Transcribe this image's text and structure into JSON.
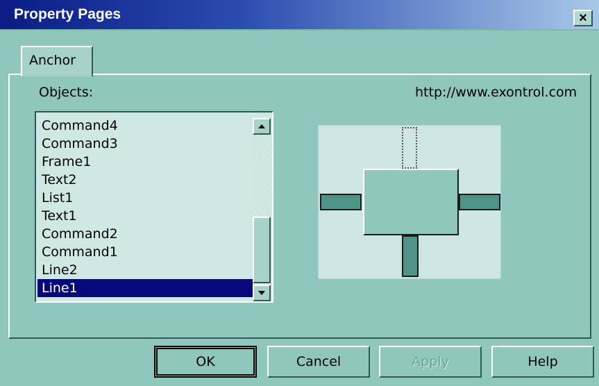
{
  "window": {
    "title": "Property Pages",
    "close_glyph": "×"
  },
  "tabs": [
    {
      "label": "Anchor",
      "selected": true
    }
  ],
  "objects": {
    "label": "Objects:",
    "items": [
      "Command4",
      "Command3",
      "Frame1",
      "Text2",
      "List1",
      "Text1",
      "Command2",
      "Command1",
      "Line2",
      "Line1"
    ],
    "selected": "Line1"
  },
  "url": "http://www.exontrol.com",
  "preview": {
    "top_anchor": "dotted",
    "left_anchor": "solid",
    "right_anchor": "solid",
    "bottom_anchor": "solid"
  },
  "buttons": {
    "ok": "OK",
    "cancel": "Cancel",
    "apply": "Apply",
    "help": "Help"
  },
  "colors": {
    "dialog_bg": "#8fc7bd",
    "title_gradient_start": "#0a1c86",
    "selection_bg": "#08087a",
    "anchor_bar": "#4f9488"
  }
}
